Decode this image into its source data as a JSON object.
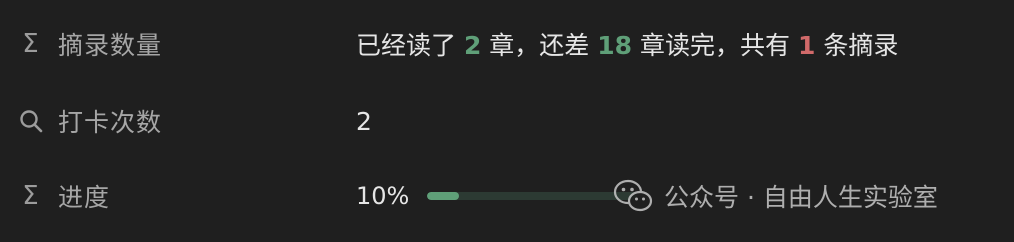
{
  "rows": [
    {
      "icon": "sigma-icon",
      "label": "摘录数量",
      "value_parts": [
        "已经读了 ",
        "2",
        " 章，还差 ",
        "18",
        " 章读完，共有 ",
        "1",
        " 条摘录"
      ]
    },
    {
      "icon": "search-icon",
      "label": "打卡次数",
      "value": "2"
    },
    {
      "icon": "sigma-icon",
      "label": "进度",
      "percent_text": "10%",
      "progress_fraction": 0.15
    }
  ],
  "watermark": {
    "icon": "wechat-icon",
    "text": "公众号 · 自由人生实验室"
  },
  "colors": {
    "accent_green": "#5f9f78",
    "accent_red": "#d16a6a",
    "background": "#1f1f1f"
  }
}
